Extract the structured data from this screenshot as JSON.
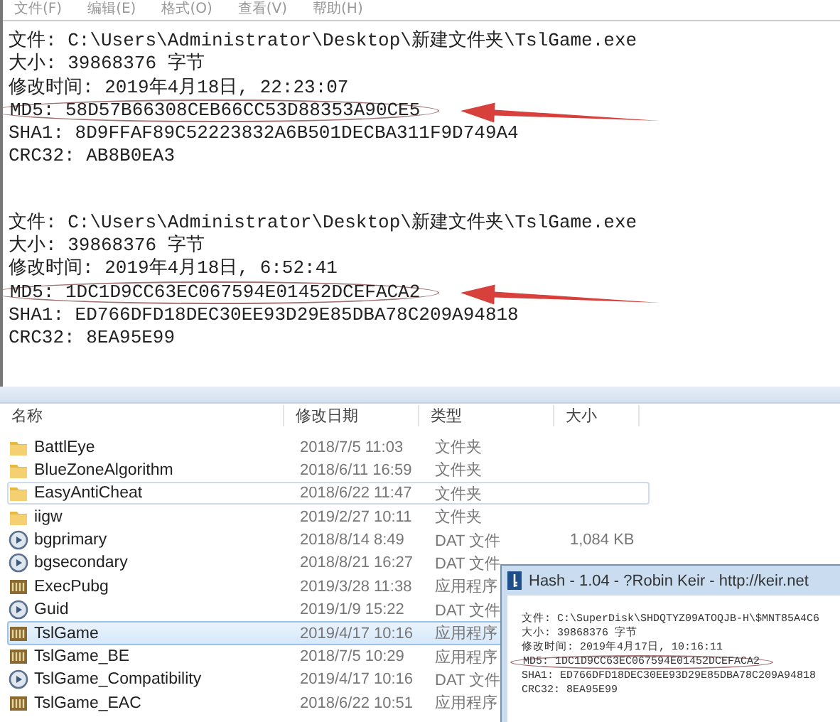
{
  "notepad": {
    "menu": [
      "文件(F)",
      "编辑(E)",
      "格式(O)",
      "查看(V)",
      "帮助(H)"
    ],
    "blocks": [
      {
        "lines": [
          {
            "text": "文件: C:\\Users\\Administrator\\Desktop\\新建文件夹\\TslGame.exe",
            "circled": false
          },
          {
            "text": "大小: 39868376 字节",
            "circled": false
          },
          {
            "text": "修改时间: 2019年4月18日, 22:23:07",
            "circled": false
          },
          {
            "text": "MD5: 58D57B66308CEB66CC53D88353A90CE5",
            "circled": true
          },
          {
            "text": "SHA1: 8D9FFAF89C52223832A6B501DECBA311F9D749A4",
            "circled": false
          },
          {
            "text": "CRC32: AB8B0EA3",
            "circled": false
          }
        ]
      },
      {
        "lines": [
          {
            "text": "文件: C:\\Users\\Administrator\\Desktop\\新建文件夹\\TslGame.exe",
            "circled": false
          },
          {
            "text": "大小: 39868376 字节",
            "circled": false
          },
          {
            "text": "修改时间: 2019年4月18日, 6:52:41",
            "circled": false
          },
          {
            "text": "MD5: 1DC1D9CC63EC067594E01452DCEFACA2",
            "circled": true
          },
          {
            "text": "SHA1: ED766DFD18DEC30EE93D29E85DBA78C209A94818",
            "circled": false
          },
          {
            "text": "CRC32: 8EA95E99",
            "circled": false
          }
        ]
      }
    ]
  },
  "explorer": {
    "columns": [
      "名称",
      "修改日期",
      "类型",
      "大小"
    ],
    "rows": [
      {
        "kind": "folder",
        "name": "BattlEye",
        "date": "2018/7/5 11:03",
        "type": "文件夹",
        "selected": false,
        "hovered": false
      },
      {
        "kind": "folder",
        "name": "BlueZoneAlgorithm",
        "date": "2018/6/11 16:59",
        "type": "文件夹",
        "selected": false,
        "hovered": false
      },
      {
        "kind": "folder",
        "name": "EasyAntiCheat",
        "date": "2018/6/22 11:47",
        "type": "文件夹",
        "selected": false,
        "hovered": true
      },
      {
        "kind": "folder",
        "name": "iigw",
        "date": "2019/2/27 10:11",
        "type": "文件夹",
        "selected": false,
        "hovered": false
      },
      {
        "kind": "dat",
        "name": "bgprimary",
        "date": "2018/8/14 8:49",
        "type": "DAT 文件",
        "size": "1,084 KB",
        "selected": false,
        "hovered": false
      },
      {
        "kind": "dat",
        "name": "bgsecondary",
        "date": "2018/8/21 16:27",
        "type": "DAT 文件",
        "selected": false,
        "hovered": false
      },
      {
        "kind": "app",
        "name": "ExecPubg",
        "date": "2019/3/28 11:38",
        "type": "应用程序",
        "selected": false,
        "hovered": false
      },
      {
        "kind": "dat",
        "name": "Guid",
        "date": "2019/1/9 15:22",
        "type": "DAT 文件",
        "selected": false,
        "hovered": false
      },
      {
        "kind": "app",
        "name": "TslGame",
        "date": "2019/4/17 10:16",
        "type": "应用程序",
        "selected": true,
        "hovered": false
      },
      {
        "kind": "app",
        "name": "TslGame_BE",
        "date": "2018/7/5 10:29",
        "type": "应用程序",
        "selected": false,
        "hovered": false
      },
      {
        "kind": "dat",
        "name": "TslGame_Compatibility",
        "date": "2019/4/17 10:16",
        "type": "DAT 文件",
        "selected": false,
        "hovered": false
      },
      {
        "kind": "app",
        "name": "TslGame_EAC",
        "date": "2018/6/22 10:51",
        "type": "应用程序",
        "selected": false,
        "hovered": false
      }
    ]
  },
  "hash_window": {
    "title": "Hash - 1.04 - ?Robin Keir - http://keir.net",
    "lines": [
      {
        "text": "文件: C:\\SuperDisk\\SHDQTYZ09ATOQJB-H\\$MNT85A4C6",
        "circled": false
      },
      {
        "text": "大小: 39868376 字节",
        "circled": false
      },
      {
        "text": "修改时间: 2019年4月17日, 10:16:11",
        "circled": false
      },
      {
        "text": "MD5: 1DC1D9CC63EC067594E01452DCEFACA2",
        "circled": true
      },
      {
        "text": "SHA1: ED766DFD18DEC30EE93D29E85DBA78C209A94818",
        "circled": false
      },
      {
        "text": "CRC32: 8EA95E99",
        "circled": false
      }
    ]
  }
}
